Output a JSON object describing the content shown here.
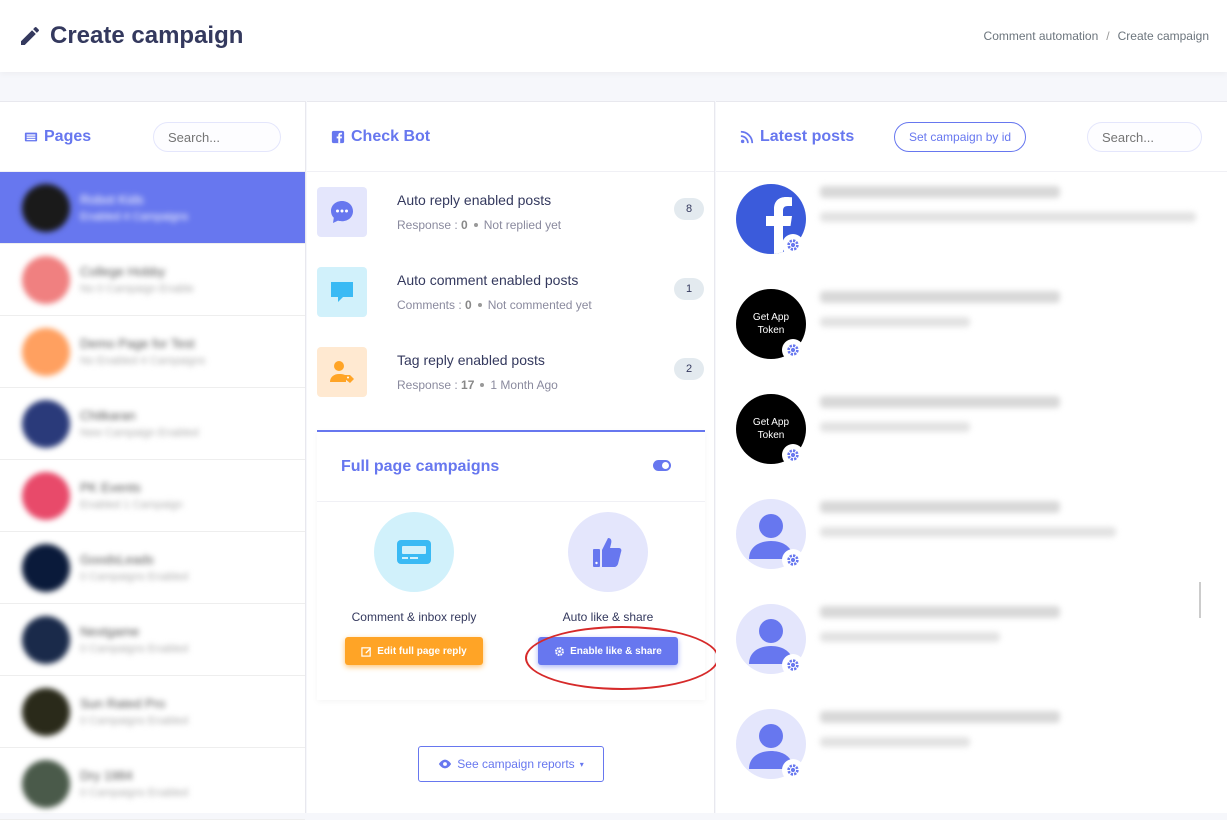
{
  "header": {
    "title": "Create campaign"
  },
  "breadcrumb": {
    "item1": "Comment automation",
    "sep": "/",
    "item2": "Create campaign"
  },
  "pages_panel": {
    "title": "Pages",
    "search_placeholder": "Search...",
    "items": [
      {
        "name": "Robot Kids",
        "sub": "Enabled 4 Campaigns",
        "avatar_color": "#1a1a1a",
        "active": true
      },
      {
        "name": "College Hobby",
        "sub": "No 0 Campaign Enable",
        "avatar_color": "#f08080",
        "active": false
      },
      {
        "name": "Demo Page for Test",
        "sub": "No Enabled 4 Campaigns",
        "avatar_color": "#ffa060",
        "active": false
      },
      {
        "name": "Chitkaran",
        "sub": "New Campaign Enabled",
        "avatar_color": "#2a3a7a",
        "active": false
      },
      {
        "name": "PK Events",
        "sub": "Enabled 1 Campaign",
        "avatar_color": "#e84a6a",
        "active": false
      },
      {
        "name": "GoodsLeads",
        "sub": "0 Campaigns Enabled",
        "avatar_color": "#0a1a3a",
        "active": false
      },
      {
        "name": "Nextgame",
        "sub": "0 Campaigns Enabled",
        "avatar_color": "#1a2a4a",
        "active": false
      },
      {
        "name": "Sun Rated Pro",
        "sub": "0 Campaigns Enabled",
        "avatar_color": "#2a2a1a",
        "active": false
      },
      {
        "name": "Dry 1984",
        "sub": "0 Campaigns Enabled",
        "avatar_color": "#4a5a4a",
        "active": false
      }
    ]
  },
  "check_bot": {
    "title": "Check Bot",
    "rows": [
      {
        "title": "Auto reply enabled posts",
        "meta_label": "Response :",
        "meta_value": "0",
        "meta_extra": "Not replied yet",
        "count": "8",
        "icon_bg": "#e4e6fc",
        "icon_color": "#6777ef"
      },
      {
        "title": "Auto comment enabled posts",
        "meta_label": "Comments :",
        "meta_value": "0",
        "meta_extra": "Not commented yet",
        "count": "1",
        "icon_bg": "#d1f1fb",
        "icon_color": "#3abaf4"
      },
      {
        "title": "Tag reply enabled posts",
        "meta_label": "Response :",
        "meta_value": "17",
        "meta_extra": "1 Month Ago",
        "count": "2",
        "icon_bg": "#ffe9d1",
        "icon_color": "#ffa426"
      }
    ]
  },
  "full_page_campaigns": {
    "title": "Full page campaigns",
    "comment_option": {
      "label": "Comment & inbox reply",
      "button": "Edit full page reply"
    },
    "like_option": {
      "label": "Auto like & share",
      "button": "Enable like & share"
    }
  },
  "see_reports_label": "See campaign reports",
  "latest_posts": {
    "title": "Latest posts",
    "set_button": "Set campaign by id",
    "search_placeholder": "Search...",
    "posts": [
      {
        "type": "facebook",
        "line1": "173052771043381_2418790047752424",
        "line2": "9 Month Ago - Lorem ipsum dolor sit amet consectetur adipiscing elit sed do eiusmod"
      },
      {
        "type": "token",
        "token_text": "Get App Token",
        "line1": "173052771043381_2415062813129849",
        "line2": "9 Month Ago - This is test"
      },
      {
        "type": "token",
        "token_text": "Get App Token",
        "line1": "173052771043381_2415058954405381",
        "line2": "9 Month Ago - This is test"
      },
      {
        "type": "user",
        "line1": "173052771043381_2385260921374791",
        "line2": "9 Month Ago - automated post test one two"
      },
      {
        "type": "user",
        "line1": "173052771043381_2337473816037781",
        "line2": "9 Month Ago - post title sample"
      },
      {
        "type": "user",
        "line1": "173052771043381_2337483354334741",
        "line2": "9 Month Ago - Quantity"
      }
    ]
  },
  "colors": {
    "primary": "#6777ef",
    "orange": "#ffa426",
    "info": "#3abaf4",
    "annotation": "#d62a2a"
  }
}
